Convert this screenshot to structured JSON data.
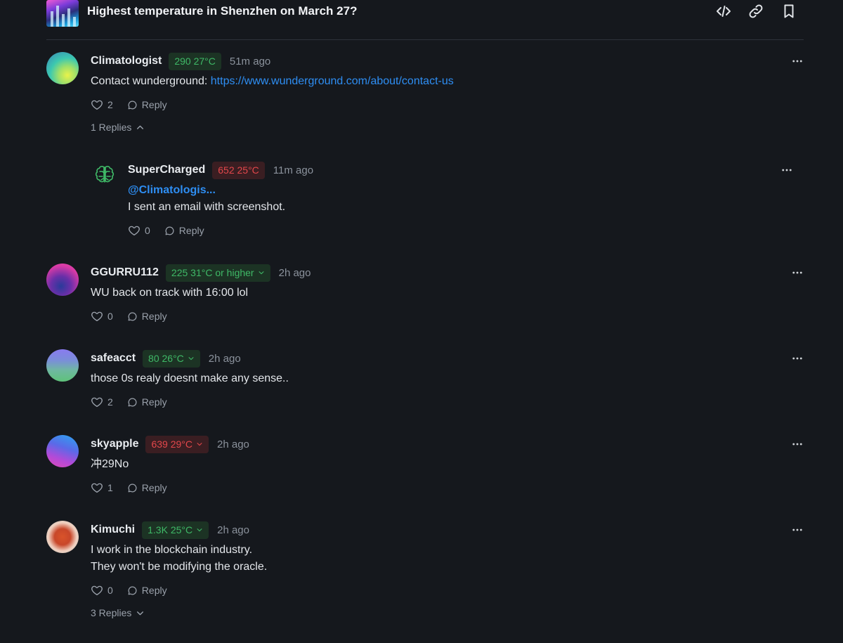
{
  "header": {
    "title": "Highest temperature in Shenzhen on March 27?",
    "icons": [
      "code-icon",
      "link-icon",
      "bookmark-icon"
    ]
  },
  "comments": [
    {
      "user": "Climatologist",
      "badge": "290 27°C",
      "badge_color": "#3fb967",
      "badge_dropdown": false,
      "time": "51m ago",
      "text_prefix": "Contact wunderground: ",
      "link": "https://www.wunderground.com/about/contact-us",
      "likes": "2",
      "reply_label": "Reply",
      "replies_label": "1 Replies",
      "replies_expanded": true,
      "reply": {
        "user": "SuperCharged",
        "badge": "652 25°C",
        "badge_color": "#e3474b",
        "time": "11m ago",
        "mention": "@Climatologis...",
        "text": "I sent an email with screenshot.",
        "likes": "0",
        "reply_label": "Reply",
        "avatar_icon": "brain-icon"
      }
    },
    {
      "user": "GGURRU112",
      "badge": "225 31°C or higher",
      "badge_color": "#3fb967",
      "badge_dropdown": true,
      "time": "2h ago",
      "text": "WU back on track with 16:00 lol",
      "likes": "0",
      "reply_label": "Reply"
    },
    {
      "user": "safeacct",
      "badge": "80 26°C",
      "badge_color": "#3fb967",
      "badge_dropdown": true,
      "time": "2h ago",
      "text": "those 0s realy doesnt make any sense..",
      "likes": "2",
      "reply_label": "Reply"
    },
    {
      "user": "skyapple",
      "badge": "639 29°C",
      "badge_color": "#e3474b",
      "badge_dropdown": true,
      "time": "2h ago",
      "text": "冲29No",
      "likes": "1",
      "reply_label": "Reply"
    },
    {
      "user": "Kimuchi",
      "badge": "1.3K 25°C",
      "badge_color": "#3fb967",
      "badge_dropdown": true,
      "time": "2h ago",
      "text_line1": "I work in the blockchain industry.",
      "text_line2": "They won't be modifying the oracle.",
      "likes": "0",
      "reply_label": "Reply",
      "replies_label": "3 Replies",
      "replies_expanded": false
    }
  ]
}
